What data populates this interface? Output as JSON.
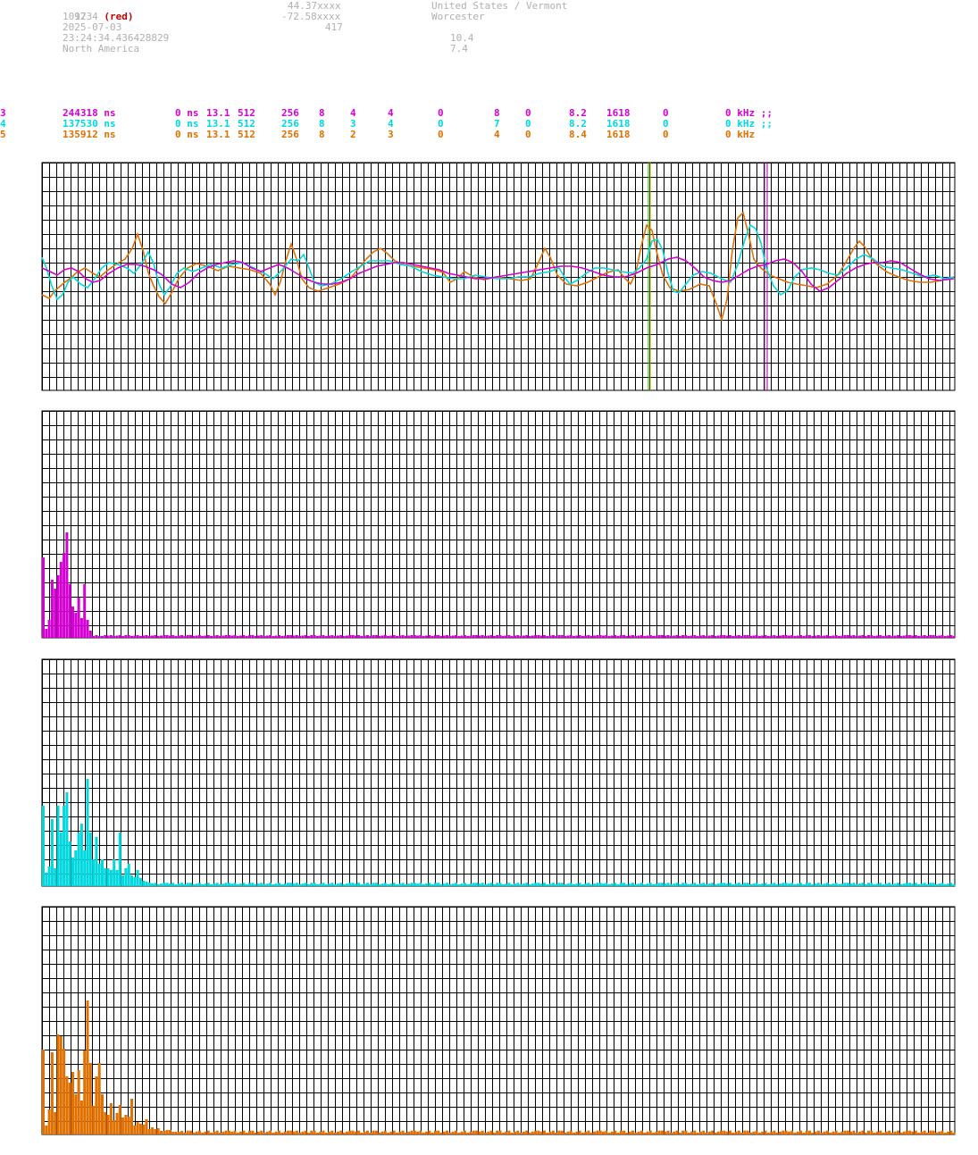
{
  "header": {
    "col1": [
      "1234",
      "1097",
      "2025-07-03",
      "23:24:34.436428829",
      "North America"
    ],
    "col1_red_suffix": "(red)",
    "col2": [
      "44.37xxxx",
      "-72.58xxxx",
      "417"
    ],
    "col3": [
      "United States / Vermont",
      "Worcester"
    ],
    "col4": [
      "10.4",
      "7.4"
    ]
  },
  "channels": [
    {
      "id": "3",
      "ns": "244318 ns",
      "f1": "0 ns",
      "f2": "13.1",
      "f3": "512",
      "f4": "256",
      "f5": "8",
      "f6": "4",
      "f7": "4",
      "f8": "0",
      "f9": "8",
      "f10": "0",
      "f11": "8.2",
      "f12": "1618",
      "f13": "0",
      "f14": "0 kHz ;;",
      "color": "#d400d4"
    },
    {
      "id": "4",
      "ns": "137530 ns",
      "f1": "0 ns",
      "f2": "13.1",
      "f3": "512",
      "f4": "256",
      "f5": "8",
      "f6": "3",
      "f7": "4",
      "f8": "0",
      "f9": "7",
      "f10": "0",
      "f11": "8.2",
      "f12": "1618",
      "f13": "0",
      "f14": "0 kHz ;;",
      "color": "#00d8e0"
    },
    {
      "id": "5",
      "ns": "135912 ns",
      "f1": "0 ns",
      "f2": "13.1",
      "f3": "512",
      "f4": "256",
      "f5": "8",
      "f6": "2",
      "f7": "3",
      "f8": "0",
      "f9": "4",
      "f10": "0",
      "f11": "8.4",
      "f12": "1618",
      "f13": "0",
      "f14": "0 kHz",
      "color": "#e07000"
    }
  ],
  "colors": {
    "magenta": "#d400d4",
    "cyan": "#00d8e0",
    "orange": "#e07000",
    "grid": "#000000"
  }
}
